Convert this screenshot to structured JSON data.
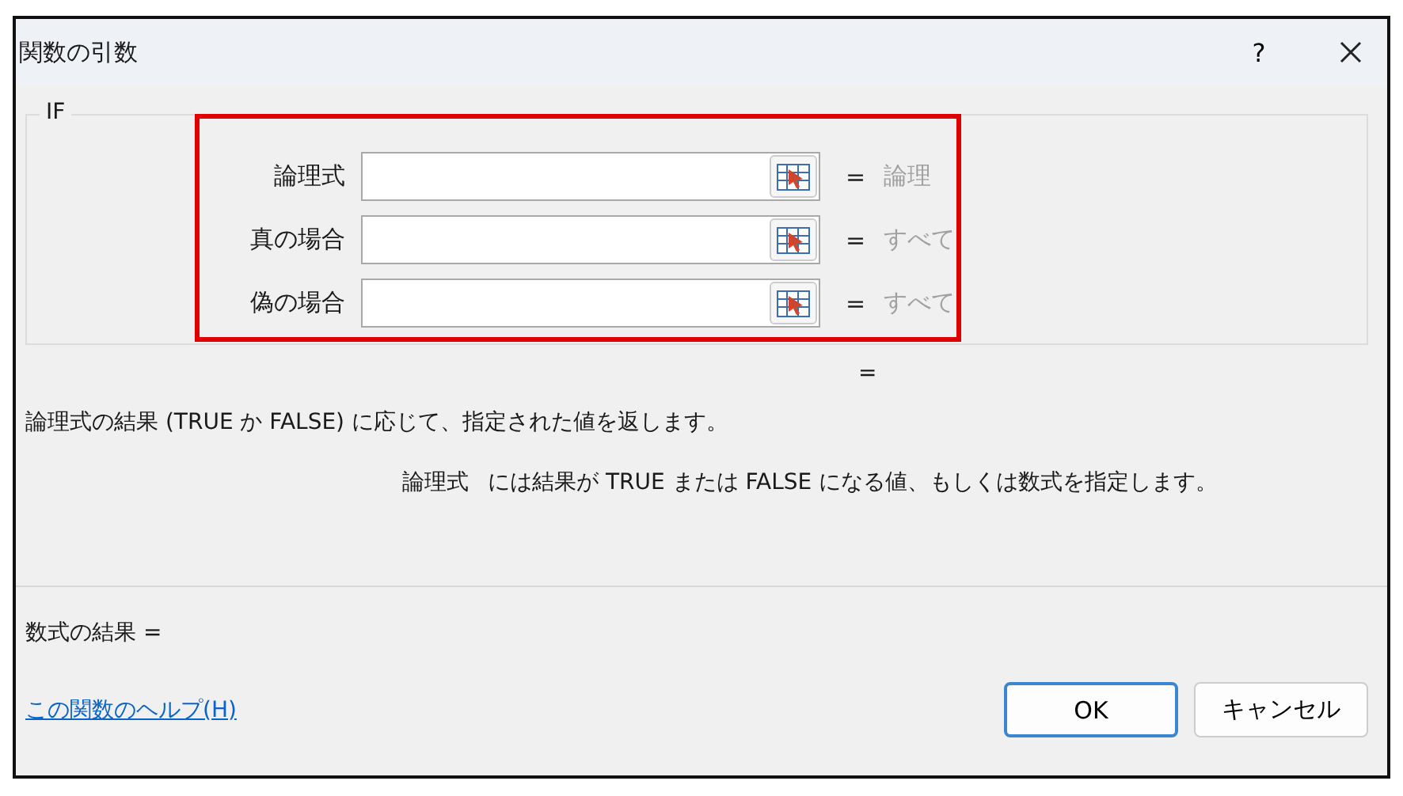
{
  "window": {
    "title": "関数の引数",
    "help_button": "?"
  },
  "function_group": {
    "name": "IF",
    "highlighted": true,
    "arguments": [
      {
        "label": "論理式",
        "equals": "=",
        "hint": "論理"
      },
      {
        "label": "真の場合",
        "equals": "=",
        "hint": "すべて"
      },
      {
        "label": "偽の場合",
        "equals": "=",
        "hint": "すべて"
      }
    ],
    "result_equals": "="
  },
  "description": "論理式の結果 (TRUE か FALSE) に応じて、指定された値を返します。",
  "argument_help": {
    "name": "論理式",
    "text": "には結果が TRUE または FALSE になる値、もしくは数式を指定します。"
  },
  "formula_result": "数式の結果 =",
  "help_link": "この関数のヘルプ(H)",
  "buttons": [
    {
      "label": "OK",
      "default": true
    },
    {
      "label": "キャンセル",
      "default": false
    }
  ]
}
